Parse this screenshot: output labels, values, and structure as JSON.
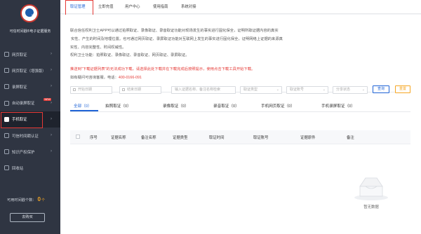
{
  "brand": {
    "name": "可信时间戳®电子证据服务"
  },
  "sidebar": {
    "items": [
      {
        "label": "网页取证"
      },
      {
        "label": "网页取证（增强版）"
      },
      {
        "label": "录屏取证"
      },
      {
        "label": "自动录屏取证",
        "badge": "NEW"
      },
      {
        "label": "手机取证"
      },
      {
        "label": "可信时间戳认证"
      },
      {
        "label": "知识产权保护"
      },
      {
        "label": "回收站"
      }
    ],
    "active_index": 4,
    "quota_label": "可用时间戳个数：",
    "quota_value": "0",
    "quota_unit": "个",
    "buy_label": "去购买"
  },
  "tabs": [
    {
      "label": "取证管理"
    },
    {
      "label": "立即充值"
    },
    {
      "label": "用户中心"
    },
    {
      "label": "使用指南"
    },
    {
      "label": "系统对接"
    }
  ],
  "notice": {
    "line1": "联合信任权利卫士APP可以通过拍照取证、录像取证、录音取证功能对现场发生的事实进行固化保全，证明所取证据内容的真实",
    "line2": "实性、产生的时间及地理位置。也可通过网页取证、录屏取证功能对互联网上发生的事实进行固化保全，证明网络上证据的来源真",
    "line3": "实性、内容完整性、时间权威性。",
    "line4": "权利卫士功能：拍照取证、录像取证、录音取证、网页取证、录屏取证。",
    "warn": "推送到\"下载证据列表\"的无法成功下载，请选择此处下载并在下载完成后按照提示，使用点击下载工具开始下载。",
    "contact_label": "如有疑问可咨询客服，电话：",
    "contact_phone": "400-0166-091"
  },
  "filters": {
    "start_date": "开始日期",
    "end_date": "结束日期",
    "keyword_placeholder": "输入证据名称、备注名称检索",
    "type_placeholder": "取证类型",
    "account_placeholder": "取证账号",
    "status_placeholder": "分享状态",
    "query_label": "查询",
    "reset_label": "重置"
  },
  "categories": [
    {
      "label": "全部（0）"
    },
    {
      "label": "拍照取证（0）"
    },
    {
      "label": "录像取证（0）"
    },
    {
      "label": "录音取证（0）"
    },
    {
      "label": "手机网页取证（0）"
    },
    {
      "label": "手机录屏取证（0）"
    }
  ],
  "table": {
    "columns": [
      "序号",
      "证据名称",
      "备注名称",
      "证据类型",
      "取证时间",
      "取证账号",
      "证据原件",
      "备注"
    ],
    "empty_text": "暂无数据"
  },
  "colors": {
    "sidebar": "#2f3542",
    "accent": "#1e63d6",
    "warning": "#e53935",
    "reset": "#f5a623"
  }
}
